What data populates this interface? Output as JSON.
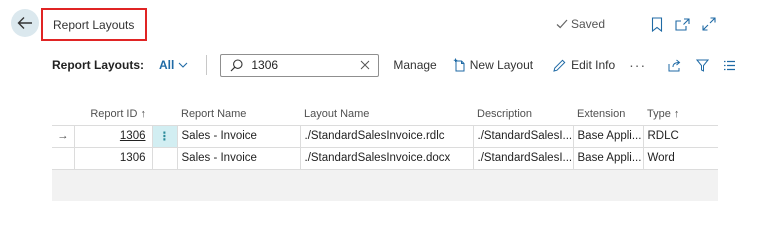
{
  "page": {
    "title": "Report Layouts",
    "saved_label": "Saved"
  },
  "action_bar": {
    "label": "Report Layouts:",
    "filter": "All",
    "search_value": "1306",
    "manage": "Manage",
    "new_layout": "New Layout",
    "edit_info": "Edit Info",
    "more": "···"
  },
  "table": {
    "columns": {
      "report_id": "Report ID",
      "report_name": "Report Name",
      "layout_name": "Layout Name",
      "description": "Description",
      "extension": "Extension",
      "type": "Type"
    },
    "rows": [
      {
        "report_id": "1306",
        "report_name": "Sales - Invoice",
        "layout_name": "./StandardSalesInvoice.rdlc",
        "description": "./StandardSalesI...",
        "extension": "Base Appli...",
        "type": "RDLC"
      },
      {
        "report_id": "1306",
        "report_name": "Sales - Invoice",
        "layout_name": "./StandardSalesInvoice.docx",
        "description": "./StandardSalesI...",
        "extension": "Base Appli...",
        "type": "Word"
      }
    ]
  },
  "colors": {
    "accent": "#1f6aa5",
    "title_border": "#e02424",
    "back_button_bg": "#dbe8ee",
    "selected_cell": "#d2eef2"
  },
  "icons": {
    "back": "arrow-left-icon",
    "saved": "checkmark-icon",
    "bookmark": "bookmark-icon",
    "open_new": "open-in-new-window-icon",
    "expand": "expand-icon",
    "search": "search-icon",
    "clear": "close-icon",
    "new": "new-document-icon",
    "edit": "pencil-icon",
    "share": "share-icon",
    "filter": "filter-icon",
    "list": "list-view-icon"
  }
}
